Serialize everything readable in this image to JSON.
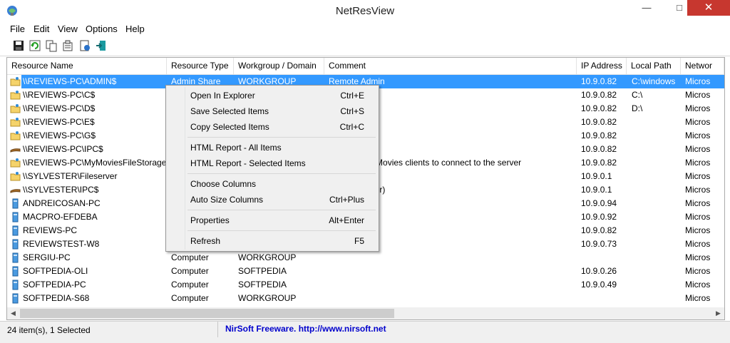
{
  "window": {
    "title": "NetResView",
    "minimize": "—",
    "maximize": "□",
    "close": "✕"
  },
  "menu": [
    "File",
    "Edit",
    "View",
    "Options",
    "Help"
  ],
  "toolbar": [
    "save-icon",
    "refresh-icon",
    "copy-icon",
    "properties-icon",
    "html-report-icon",
    "exit-icon"
  ],
  "columns": [
    "Resource Name",
    "Resource Type",
    "Workgroup / Domain",
    "Comment",
    "IP Address",
    "Local Path",
    "Networ"
  ],
  "rows": [
    {
      "icon": "share-folder",
      "name": "\\\\REVIEWS-PC\\ADMIN$",
      "type": "Admin Share",
      "group": "WORKGROUP",
      "comment": "Remote Admin",
      "ip": "10.9.0.82",
      "path": "C:\\windows",
      "net": "Micros",
      "selected": true
    },
    {
      "icon": "share-folder",
      "name": "\\\\REVIEWS-PC\\C$",
      "type": "",
      "group": "",
      "comment": "",
      "ip": "10.9.0.82",
      "path": "C:\\",
      "net": "Micros"
    },
    {
      "icon": "share-folder",
      "name": "\\\\REVIEWS-PC\\D$",
      "type": "",
      "group": "",
      "comment": "",
      "ip": "10.9.0.82",
      "path": "D:\\",
      "net": "Micros"
    },
    {
      "icon": "share-folder",
      "name": "\\\\REVIEWS-PC\\E$",
      "type": "",
      "group": "",
      "comment": "",
      "ip": "10.9.0.82",
      "path": "",
      "net": "Micros"
    },
    {
      "icon": "share-folder",
      "name": "\\\\REVIEWS-PC\\G$",
      "type": "",
      "group": "",
      "comment": "",
      "ip": "10.9.0.82",
      "path": "",
      "net": "Micros"
    },
    {
      "icon": "ipc-pipe",
      "name": "\\\\REVIEWS-PC\\IPC$",
      "type": "",
      "group": "",
      "comment": "",
      "ip": "10.9.0.82",
      "path": "",
      "net": "Micros"
    },
    {
      "icon": "share-folder",
      "name": "\\\\REVIEWS-PC\\MyMoviesFileStorage$",
      "type": "",
      "group": "",
      "comment": "used for My Movies clients to connect to the server",
      "ip": "10.9.0.82",
      "path": "",
      "net": "Micros"
    },
    {
      "icon": "share-folder",
      "name": "\\\\SYLVESTER\\Fileserver",
      "type": "",
      "group": "",
      "comment": "",
      "ip": "10.9.0.1",
      "path": "",
      "net": "Micros"
    },
    {
      "icon": "ipc-pipe",
      "name": "\\\\SYLVESTER\\IPC$",
      "type": "",
      "group": "",
      "comment": "PIS Fileserver)",
      "ip": "10.9.0.1",
      "path": "",
      "net": "Micros"
    },
    {
      "icon": "computer",
      "name": "ANDREICOSAN-PC",
      "type": "",
      "group": "",
      "comment": "",
      "ip": "10.9.0.94",
      "path": "",
      "net": "Micros"
    },
    {
      "icon": "computer",
      "name": "MACPRO-EFDEBA",
      "type": "",
      "group": "",
      "comment": "t (Mac Pro)",
      "ip": "10.9.0.92",
      "path": "",
      "net": "Micros"
    },
    {
      "icon": "computer",
      "name": "REVIEWS-PC",
      "type": "",
      "group": "",
      "comment": "",
      "ip": "10.9.0.82",
      "path": "",
      "net": "Micros"
    },
    {
      "icon": "computer",
      "name": "REVIEWSTEST-W8",
      "type": "",
      "group": "",
      "comment": "",
      "ip": "10.9.0.73",
      "path": "",
      "net": "Micros"
    },
    {
      "icon": "computer",
      "name": "SERGIU-PC",
      "type": "Computer",
      "group": "WORKGROUP",
      "comment": "",
      "ip": "",
      "path": "",
      "net": "Micros"
    },
    {
      "icon": "computer",
      "name": "SOFTPEDIA-OLI",
      "type": "Computer",
      "group": "SOFTPEDIA",
      "comment": "",
      "ip": "10.9.0.26",
      "path": "",
      "net": "Micros"
    },
    {
      "icon": "computer",
      "name": "SOFTPEDIA-PC",
      "type": "Computer",
      "group": "SOFTPEDIA",
      "comment": "",
      "ip": "10.9.0.49",
      "path": "",
      "net": "Micros"
    },
    {
      "icon": "computer",
      "name": "SOFTPEDIA-S68",
      "type": "Computer",
      "group": "WORKGROUP",
      "comment": "",
      "ip": "",
      "path": "",
      "net": "Micros"
    }
  ],
  "context_menu": [
    {
      "label": "Open In Explorer",
      "key": "Ctrl+E"
    },
    {
      "label": "Save Selected Items",
      "key": "Ctrl+S"
    },
    {
      "label": "Copy Selected Items",
      "key": "Ctrl+C"
    },
    {
      "sep": true
    },
    {
      "label": "HTML Report - All Items",
      "key": ""
    },
    {
      "label": "HTML Report - Selected Items",
      "key": ""
    },
    {
      "sep": true
    },
    {
      "label": "Choose Columns",
      "key": ""
    },
    {
      "label": "Auto Size Columns",
      "key": "Ctrl+Plus"
    },
    {
      "sep": true
    },
    {
      "label": "Properties",
      "key": "Alt+Enter"
    },
    {
      "sep": true
    },
    {
      "label": "Refresh",
      "key": "F5"
    }
  ],
  "status": {
    "count": "24 item(s), 1 Selected",
    "link": "NirSoft Freeware.  http://www.nirsoft.net"
  },
  "colors": {
    "selection": "#3399ff",
    "close": "#c7372f",
    "link": "#0000cc"
  }
}
